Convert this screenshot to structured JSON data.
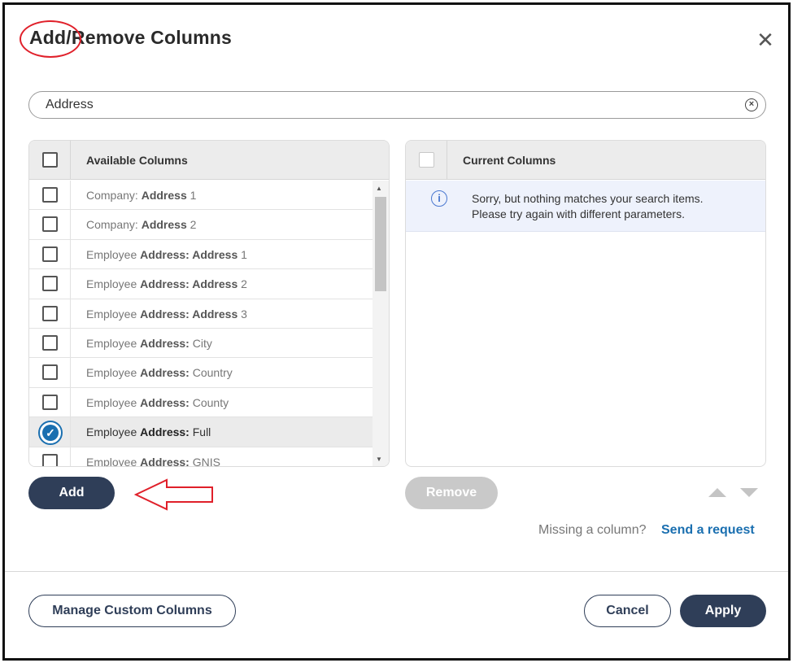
{
  "dialog": {
    "title": "Add/Remove Columns",
    "close_icon": "close-icon"
  },
  "search": {
    "value": "Address",
    "clear_icon": "clear-circle-icon"
  },
  "available": {
    "header": "Available Columns",
    "rows": [
      {
        "prefix": "Company: ",
        "bold": "Address",
        "suffix": " 1",
        "checked": false
      },
      {
        "prefix": "Company: ",
        "bold": "Address",
        "suffix": " 2",
        "checked": false
      },
      {
        "prefix": "Employee ",
        "bold": "Address: Address",
        "suffix": " 1",
        "checked": false
      },
      {
        "prefix": "Employee ",
        "bold": "Address: Address",
        "suffix": " 2",
        "checked": false
      },
      {
        "prefix": "Employee ",
        "bold": "Address: Address",
        "suffix": " 3",
        "checked": false
      },
      {
        "prefix": "Employee ",
        "bold": "Address:",
        "suffix": " City",
        "checked": false
      },
      {
        "prefix": "Employee ",
        "bold": "Address:",
        "suffix": " Country",
        "checked": false
      },
      {
        "prefix": "Employee ",
        "bold": "Address:",
        "suffix": " County",
        "checked": false
      },
      {
        "prefix": "Employee ",
        "bold": "Address:",
        "suffix": " Full",
        "checked": true
      },
      {
        "prefix": "Employee ",
        "bold": "Address:",
        "suffix": " GNIS",
        "checked": false
      }
    ]
  },
  "current": {
    "header": "Current Columns",
    "notice_line1": "Sorry, but nothing matches your search items.",
    "notice_line2": "Please try again with different parameters.",
    "info_icon": "info-icon"
  },
  "actions": {
    "add_label": "Add",
    "remove_label": "Remove",
    "missing_text": "Missing a column?",
    "send_request_label": "Send a request"
  },
  "footer": {
    "manage_label": "Manage Custom Columns",
    "cancel_label": "Cancel",
    "apply_label": "Apply"
  },
  "colors": {
    "primary": "#2f3e58",
    "link": "#1a6fb0",
    "annotation": "#e0202a",
    "disabled": "#c9c9c9"
  }
}
